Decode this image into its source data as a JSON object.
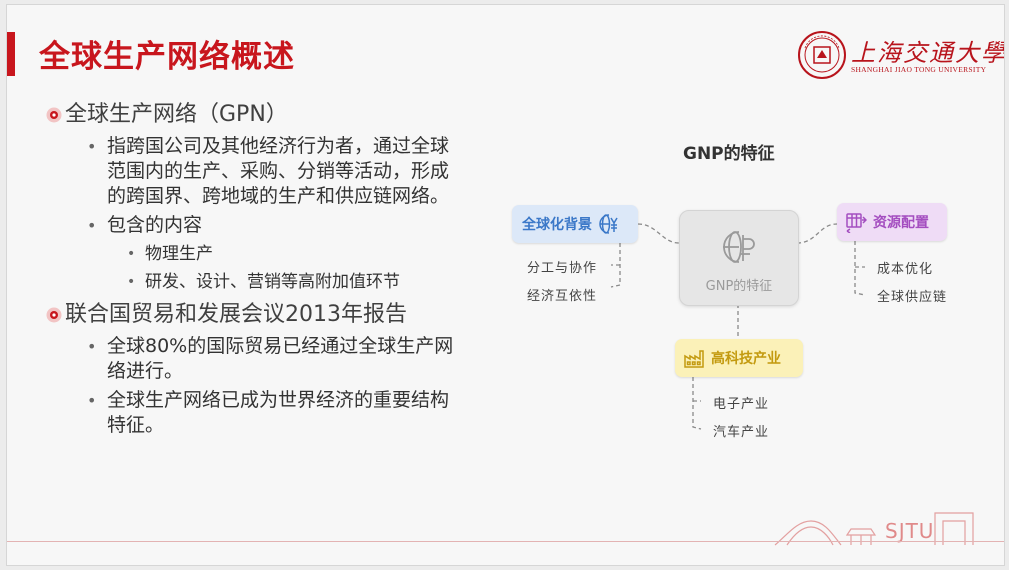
{
  "slide": {
    "title": "全球生产网络概述",
    "logo": {
      "name_cn": "上海交通大學",
      "name_en": "SHANGHAI JIAO TONG UNIVERSITY"
    },
    "content": {
      "sec1": {
        "heading": "全球生产网络（GPN）",
        "points": [
          "指跨国公司及其他经济行为者，通过全球范围内的生产、采购、分销等活动，形成的跨国界、跨地域的生产和供应链网络。",
          "包含的内容"
        ],
        "subpoints": [
          "物理生产",
          "研发、设计、营销等高附加值环节"
        ]
      },
      "sec2": {
        "heading": "联合国贸易和发展会议2013年报告",
        "points": [
          "全球80%的国际贸易已经通过全球生产网络进行。",
          "全球生产网络已成为世界经济的重要结构特征。"
        ]
      }
    },
    "diagram": {
      "title": "GNP的特征",
      "center_label": "GNP的特征",
      "blue": {
        "label": "全球化背景",
        "icon": "globe-currency-icon",
        "children": [
          "分工与协作",
          "经济互依性"
        ]
      },
      "purple": {
        "label": "资源配置",
        "icon": "resource-allocation-icon",
        "children": [
          "成本优化",
          "全球供应链"
        ]
      },
      "yellow": {
        "label": "高科技产业",
        "icon": "factory-icon",
        "children": [
          "电子产业",
          "汽车产业"
        ]
      }
    },
    "footer": {
      "mark": "SJTU"
    },
    "colors": {
      "accent": "#c8161d",
      "blue": "#3b78c8",
      "purple": "#a44ec0",
      "yellow": "#c39a0f"
    }
  }
}
